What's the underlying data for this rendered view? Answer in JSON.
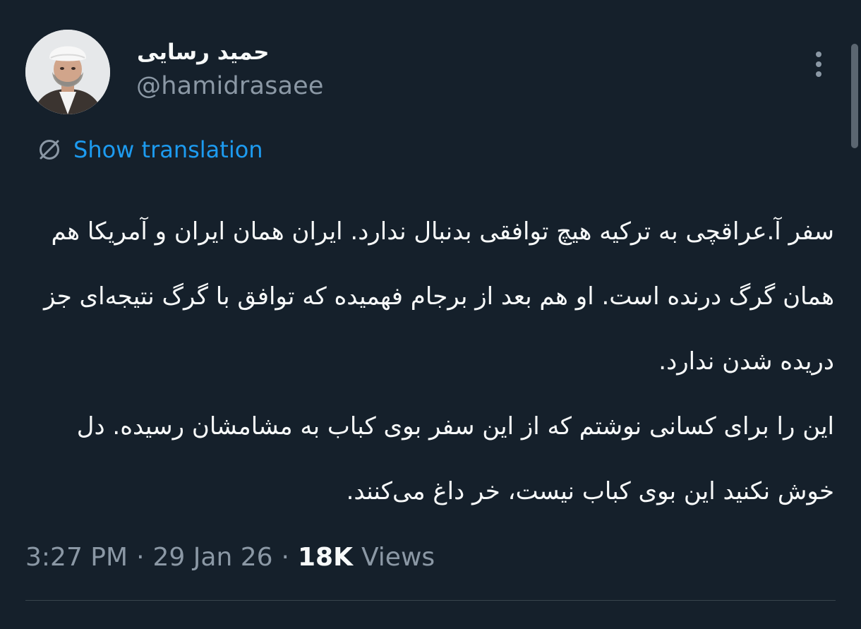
{
  "author": {
    "display_name": "حمید رسایی",
    "handle": "@hamidrasaee"
  },
  "icons": {
    "avatar": "profile-photo",
    "more": "more-vertical-icon",
    "translate": "translate-icon"
  },
  "translation": {
    "label": "Show translation"
  },
  "tweet": {
    "paragraph_1": "سفر آ.عراقچی به ترکیه هیچ توافقی بدنبال ندارد. ایران همان ایران و آمریکا هم همان گرگ درنده است. او هم بعد از برجام فهمیده که توافق با گرگ نتیجه‌ای جز دریده شدن ندارد.",
    "paragraph_2": "این را برای کسانی نوشتم که از این سفر بوی کباب به مشامشان رسیده. دل خوش نکنید این بوی کباب نیست، خر داغ می‌کنند."
  },
  "meta": {
    "time": "3:27 PM",
    "separator": "·",
    "date": "29 Jan 26",
    "views_count": "18K",
    "views_label": "Views"
  },
  "colors": {
    "background": "#15202b",
    "text_primary": "#f7f9f9",
    "text_secondary": "#8b98a5",
    "link": "#1d9bf0",
    "divider": "#38444d"
  }
}
